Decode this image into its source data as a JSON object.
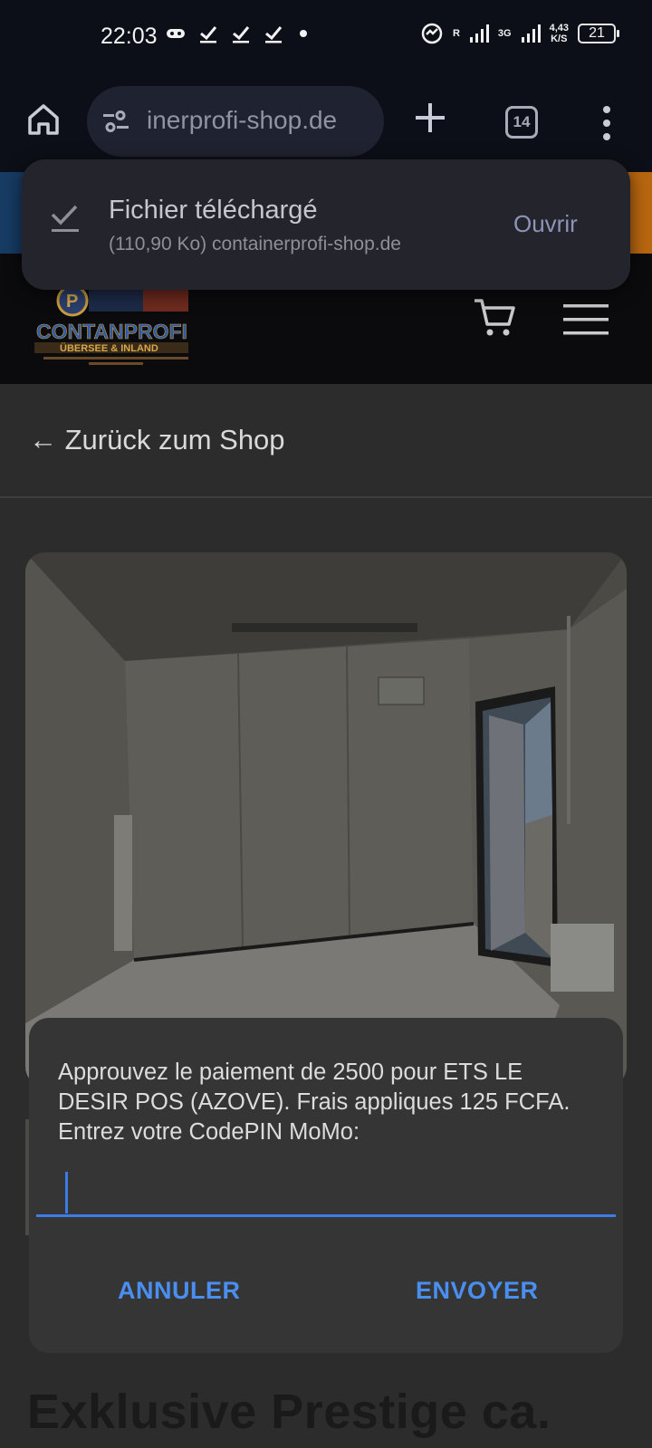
{
  "status_bar": {
    "time": "22:03",
    "network_speed_value": "4,43",
    "network_speed_unit": "K/S",
    "network_type_r": "R",
    "network_type_3g": "3G",
    "battery": "21"
  },
  "browser": {
    "url": "inerprofi-shop.de",
    "tab_count": "14"
  },
  "download_snackbar": {
    "title": "Fichier téléchargé",
    "subtitle": "(110,90 Ko) containerprofi-shop.de",
    "action_label": "Ouvrir"
  },
  "page": {
    "back_link": "← Zurück zum Shop",
    "product_title": "Exklusive Prestige ca.",
    "logo_text": "CONTANPROFI",
    "logo_subtext": "ÜBERSEE & INLAND"
  },
  "ussd_dialog": {
    "message": "Approuvez le paiement de  2500 pour ETS LE DESIR  POS (AZOVE). Frais appliques 125 FCFA. Entrez votre CodePIN MoMo:",
    "input_value": "",
    "cancel_label": "ANNULER",
    "send_label": "ENVOYER"
  },
  "colors": {
    "accent_blue": "#3d7be8",
    "button_blue": "#4a8ef0",
    "dialog_bg": "#353535"
  }
}
